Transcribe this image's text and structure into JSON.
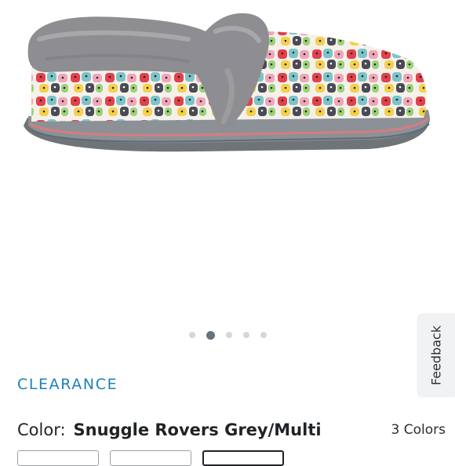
{
  "product": {
    "image_alt": "Snuggle Rovers slipper",
    "colors": {
      "fur": "#8e8e92",
      "sole": "#6f7478",
      "stripe": "#d57d82",
      "accent": "#1e81b8"
    }
  },
  "carousel": {
    "total": 5,
    "active_index": 1
  },
  "feedback": {
    "label": "Feedback"
  },
  "badge": {
    "label": "CLEARANCE"
  },
  "color": {
    "label": "Color:",
    "value": "Snuggle Rovers Grey/Multi",
    "count": "3 Colors"
  }
}
